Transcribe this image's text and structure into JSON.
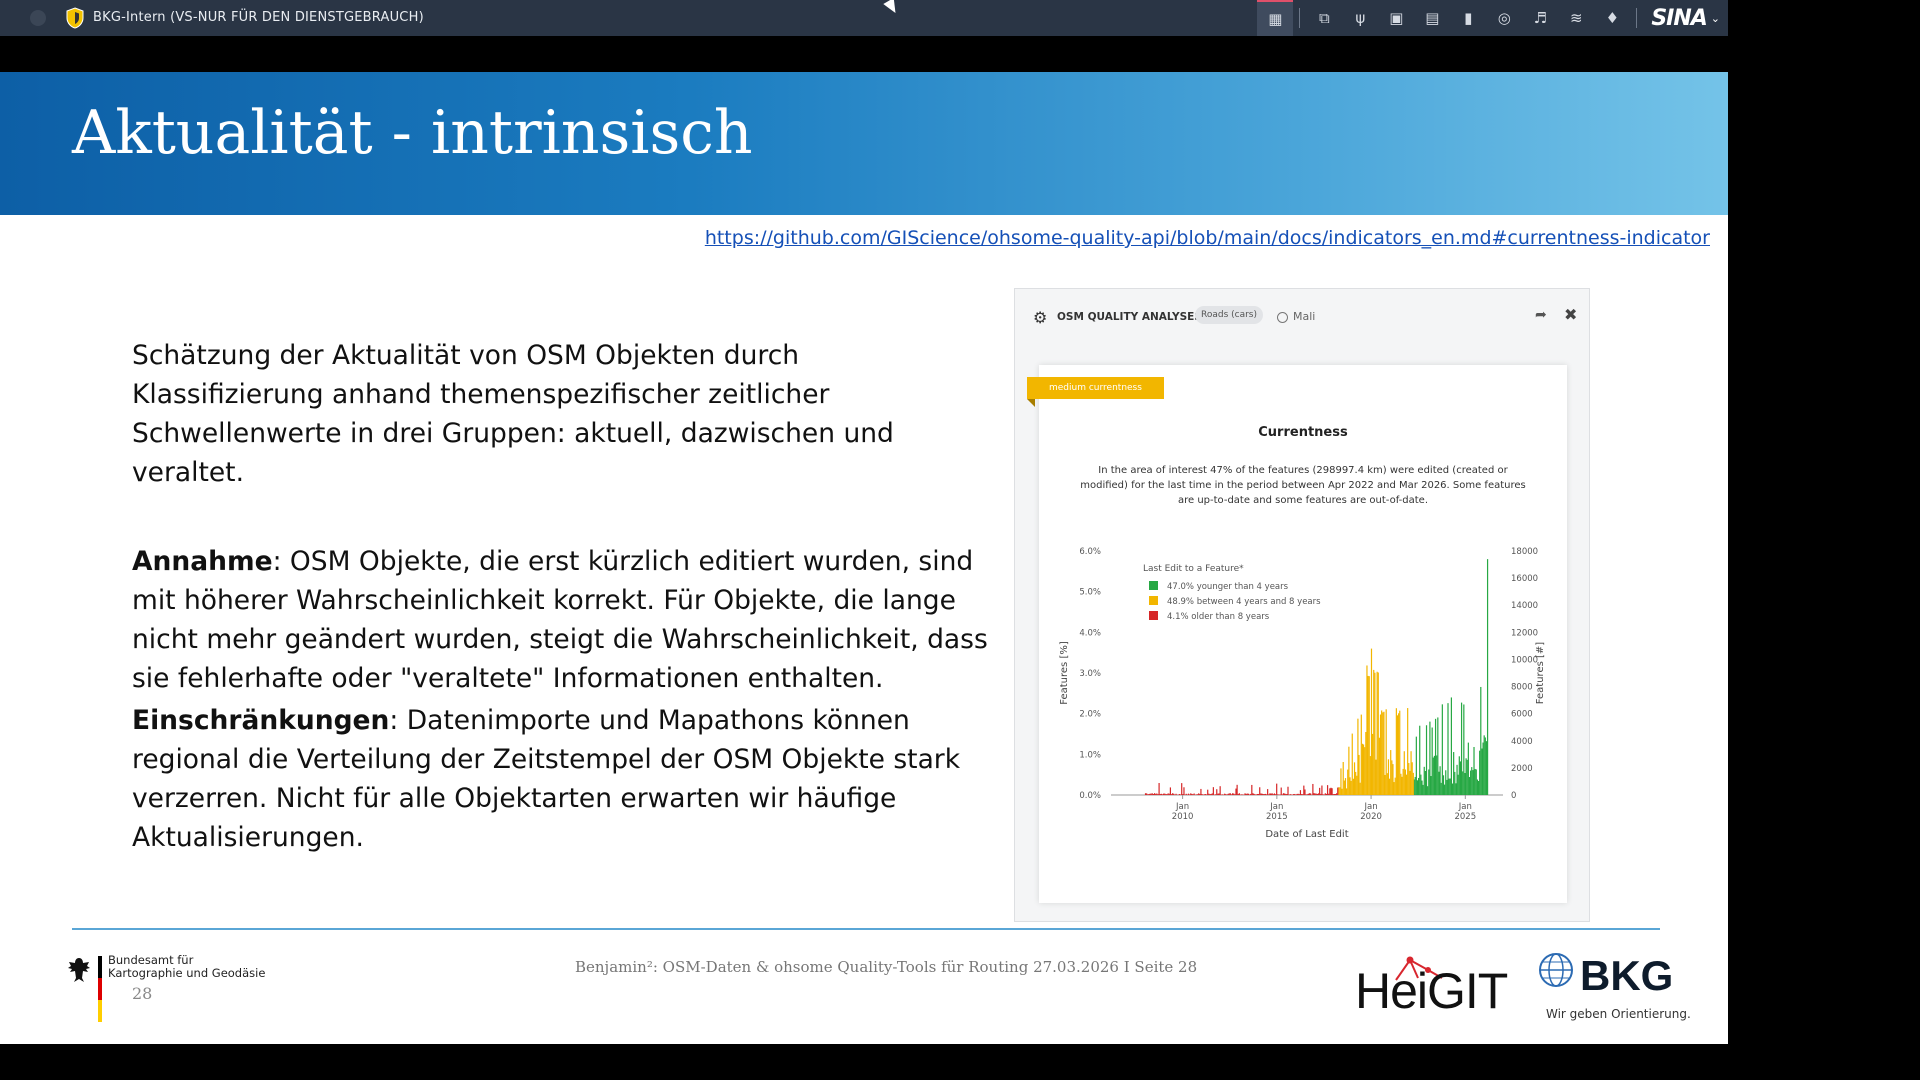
{
  "window": {
    "title": "BKG-Intern (VS-NUR FÜR DEN DIENSTGEBRAUCH)",
    "brand": "SINA"
  },
  "taskbar": {
    "icons": [
      "windows-grid-icon",
      "clipboard-stack-icon",
      "usb-icon",
      "monitor-icon",
      "clipboard-icon",
      "lock-icon",
      "microphone-icon",
      "volume-icon",
      "network-icon",
      "bell-icon"
    ]
  },
  "slide": {
    "title": "Aktualität - intrinsisch",
    "link": "https://github.com/GIScience/ohsome-quality-api/blob/main/docs/indicators_en.md#currentness-indicator",
    "p1": "Schätzung der Aktualität von OSM Objekten durch Klassifizierung anhand themenspezifischer zeitlicher Schwellenwerte in drei Gruppen: aktuell, dazwischen und veraltet.",
    "p2_bold": "Annahme",
    "p2_rest": ": OSM Objekte, die erst kürzlich editiert wurden, sind mit höherer Wahrscheinlichkeit korrekt. Für Objekte, die lange nicht mehr geändert wurden, steigt die Wahrscheinlichkeit, dass sie fehlerhafte oder \"veraltete\" Informationen enthalten.",
    "p3_bold": "Einschränkungen",
    "p3_rest": ": Datenimporte und Mapathons können regional die Verteilung der Zeitstempel der OSM Objekte stark verzerren. Nicht für alle Objektarten erwarten wir häufige Aktualisierungen."
  },
  "panel": {
    "title": "OSM QUALITY ANALYSES",
    "topic": "Roads (cars)",
    "region": "Mali",
    "badge": "medium currentness",
    "card_title": "Currentness",
    "description": "In the area of interest 47% of the features (298997.4 km) were edited (created or modified) for the last time in the period between Apr 2022 and Mar 2026. Some features are up-to-date and some features are out-of-date."
  },
  "chart_data": {
    "type": "bar",
    "legend_title": "Last Edit to a Feature*",
    "series": [
      {
        "name": "47.0% younger than 4 years",
        "color": "#27a844",
        "range": [
          2022.25,
          2026.2
        ],
        "peak": 5.8
      },
      {
        "name": "48.9% between 4 years and 8 years",
        "color": "#f2b600",
        "range": [
          2018.25,
          2022.25
        ],
        "peak": 3.6
      },
      {
        "name": "4.1% older than 8 years",
        "color": "#d62728",
        "range": [
          2008.0,
          2018.25
        ],
        "peak": 0.3
      }
    ],
    "xlabel": "Date of Last Edit",
    "ylabel_left": "Features [%]",
    "ylabel_right": "Features [#]",
    "x_ticks": [
      {
        "value": 2010,
        "label1": "Jan",
        "label2": "2010"
      },
      {
        "value": 2015,
        "label1": "Jan",
        "label2": "2015"
      },
      {
        "value": 2020,
        "label1": "Jan",
        "label2": "2020"
      },
      {
        "value": 2025,
        "label1": "Jan",
        "label2": "2025"
      }
    ],
    "xlim": [
      2006.2,
      2027.0
    ],
    "y_left_ticks": [
      "0.0%",
      "1.0%",
      "2.0%",
      "3.0%",
      "4.0%",
      "5.0%",
      "6.0%"
    ],
    "y_left_range": [
      0,
      6
    ],
    "y_right_ticks": [
      "0",
      "2000",
      "4000",
      "6000",
      "8000",
      "10000",
      "12000",
      "14000",
      "16000",
      "18000"
    ],
    "grid": false,
    "legend_position": "top-left"
  },
  "footer": {
    "org_line1": "Bundesamt für",
    "org_line2": "Kartographie und Geodäsie",
    "page_number": "28",
    "text": "Benjamin²: OSM-Daten & ohsome Quality-Tools für Routing 27.03.2026 I Seite 28",
    "heigit": "HeiGIT",
    "bkg": "BKG",
    "bkg_slogan": "Wir geben Orientierung."
  },
  "colors": {
    "banner_start": "#0d5fa6",
    "banner_end": "#74c3e8",
    "link": "#1550b7",
    "accent_line": "#5aa6d6"
  }
}
